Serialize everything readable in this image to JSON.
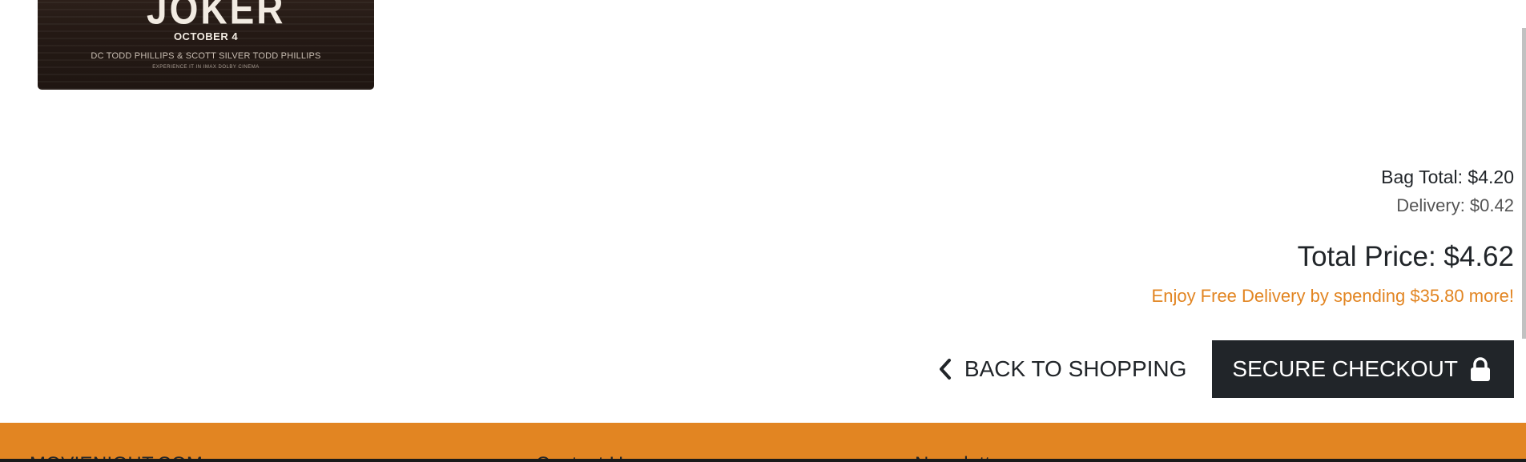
{
  "poster": {
    "title": "JOKER",
    "date": "OCTOBER 4",
    "credits": "DC  TODD PHILLIPS & SCOTT SILVER  TODD PHILLIPS",
    "footer_text": "EXPERIENCE IT IN IMAX  DOLBY CINEMA"
  },
  "summary": {
    "bag_total": "Bag Total: $4.20",
    "delivery": "Delivery: $0.42",
    "total_price": "Total Price: $4.62",
    "free_delivery_msg": "Enjoy Free Delivery by spending $35.80 more!"
  },
  "actions": {
    "back_label": "BACK TO SHOPPING",
    "back_icon": "chevron-left-icon",
    "checkout_label": "SECURE CHECKOUT",
    "checkout_icon": "lock-icon"
  },
  "footer": {
    "col1_heading": "MOVIENIGHT.COM",
    "col2_heading": "Contact Us",
    "col3_heading": "Newsletter"
  },
  "colors": {
    "accent": "#e28522",
    "dark": "#212529"
  }
}
